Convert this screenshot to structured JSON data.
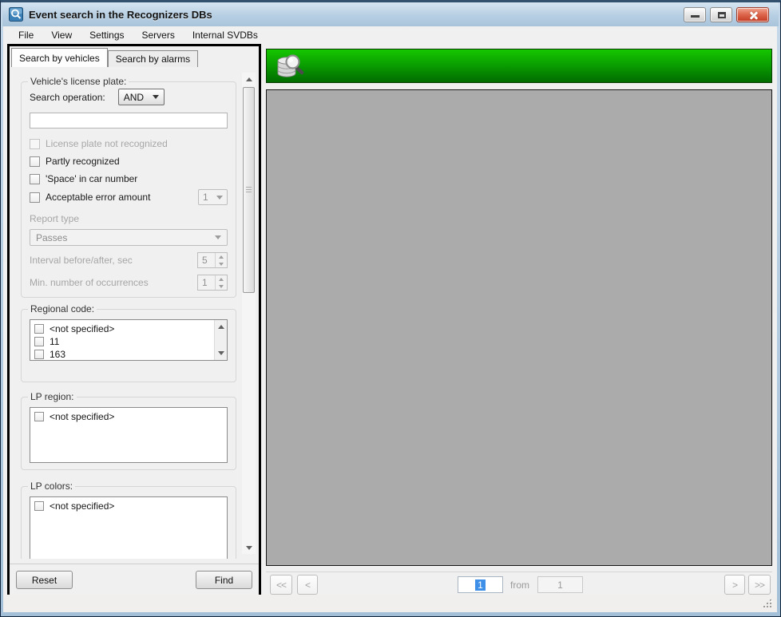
{
  "window": {
    "title": "Event search in the Recognizers DBs"
  },
  "menu": {
    "items": [
      "File",
      "View",
      "Settings",
      "Servers",
      "Internal SVDBs"
    ]
  },
  "tabs": [
    {
      "label": "Search by vehicles",
      "active": true
    },
    {
      "label": "Search by alarms",
      "active": false
    }
  ],
  "search_panel": {
    "license_group": {
      "title": "Vehicle's license plate:",
      "search_operation_label": "Search operation:",
      "search_operation_value": "AND",
      "plate_value": "",
      "checkboxes": [
        {
          "label": "License plate not recognized",
          "checked": false,
          "enabled": false
        },
        {
          "label": "Partly recognized",
          "checked": false,
          "enabled": true
        },
        {
          "label": "'Space' in car number",
          "checked": false,
          "enabled": true
        },
        {
          "label": "Acceptable error amount",
          "checked": false,
          "enabled": true
        }
      ],
      "error_amount_value": "1",
      "report_type_label": "Report type",
      "report_type_value": "Passes",
      "interval_label": "Interval before/after, sec",
      "interval_value": "5",
      "min_occurrences_label": "Min. number of occurrences",
      "min_occurrences_value": "1"
    },
    "regional_code_group": {
      "title": "Regional code:",
      "items": [
        "<not specified>",
        "11",
        "163"
      ]
    },
    "lp_region_group": {
      "title": "LP region:",
      "items": [
        "<not specified>"
      ]
    },
    "lp_colors_group": {
      "title": "LP colors:",
      "items": [
        "<not specified>"
      ]
    },
    "reset_label": "Reset",
    "find_label": "Find"
  },
  "pager": {
    "first": "<<",
    "prev": "<",
    "next": ">",
    "last": ">>",
    "page_value": "1",
    "from_label": "from",
    "total_value": "1"
  },
  "icons": {
    "app": "search-icon",
    "banner": "database-search-icon"
  },
  "colors": {
    "banner_green_top": "#16c600",
    "banner_green_bottom": "#016c00",
    "results_canvas_gray": "#ababab",
    "selection_blue": "#3d8fe8",
    "titlebar_blue": "#b7cfe3"
  }
}
